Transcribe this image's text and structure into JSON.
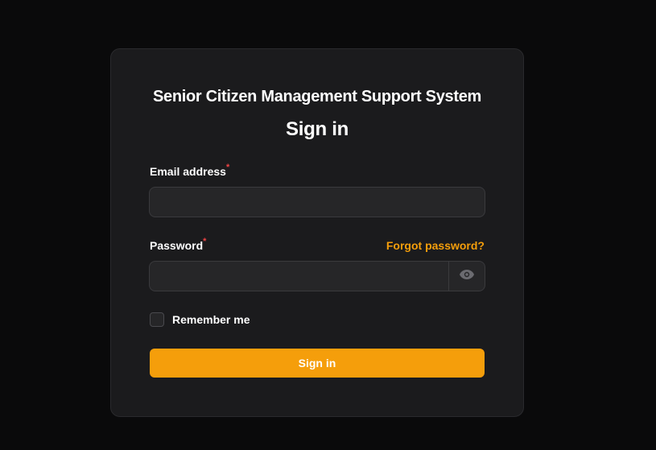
{
  "app_title": "Senior Citizen Management Support System",
  "heading": "Sign in",
  "email": {
    "label": "Email address",
    "required_mark": "*",
    "value": ""
  },
  "password": {
    "label": "Password",
    "required_mark": "*",
    "value": "",
    "forgot_link": "Forgot password?",
    "toggle_icon": "eye-icon"
  },
  "remember": {
    "label": "Remember me",
    "checked": false
  },
  "submit_label": "Sign in",
  "colors": {
    "accent": "#f59e0b",
    "required": "#ef4444",
    "card_bg": "#1b1b1d",
    "page_bg": "#0a0a0b"
  }
}
